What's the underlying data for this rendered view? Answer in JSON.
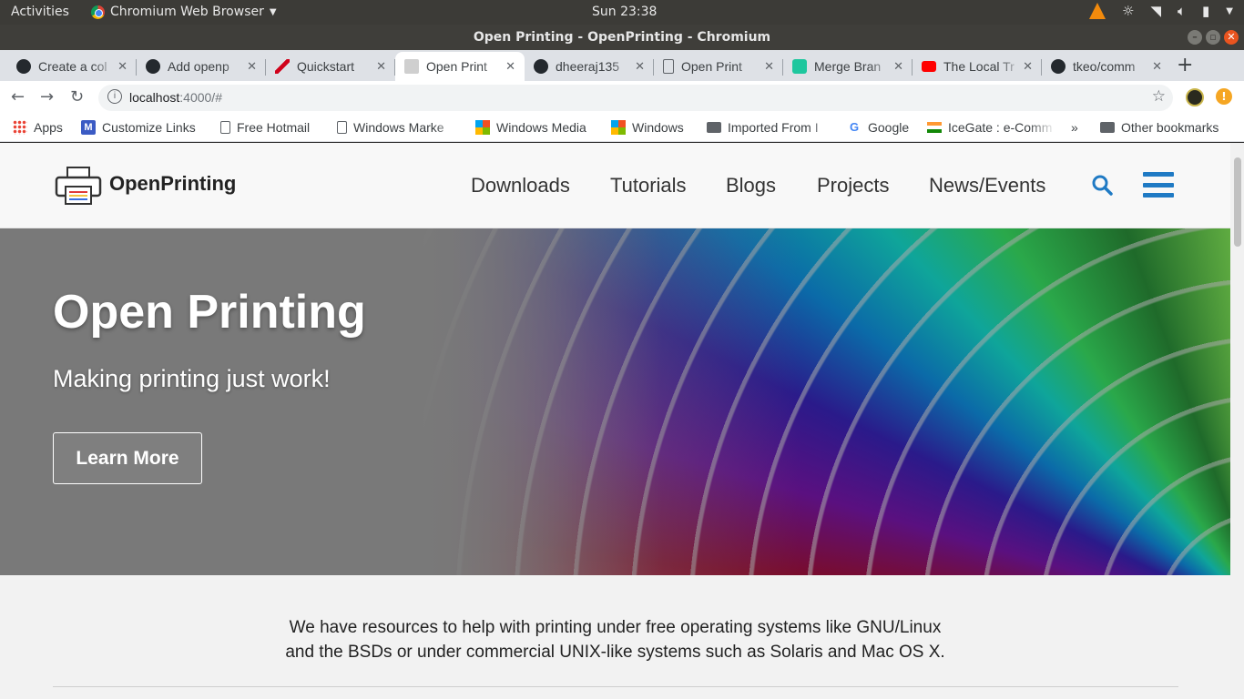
{
  "system_bar": {
    "activities": "Activities",
    "app_name": "Chromium Web Browser",
    "clock": "Sun 23:38"
  },
  "window": {
    "title": "Open Printing - OpenPrinting - Chromium"
  },
  "tabs": [
    {
      "label": "Create a col",
      "icon": "github-icon",
      "active": false
    },
    {
      "label": "Add openp",
      "icon": "github-icon",
      "active": false
    },
    {
      "label": "Quickstart",
      "icon": "pen-icon",
      "active": false
    },
    {
      "label": "Open Print",
      "icon": "printer-icon",
      "active": true
    },
    {
      "label": "dheeraj135",
      "icon": "github-icon",
      "active": false
    },
    {
      "label": "Open Print",
      "icon": "page-icon",
      "active": false
    },
    {
      "label": "Merge Bran",
      "icon": "b-icon",
      "active": false
    },
    {
      "label": "The Local Tr",
      "icon": "youtube-icon",
      "active": false
    },
    {
      "label": "tkeo/comm",
      "icon": "github-icon",
      "active": false
    }
  ],
  "address_bar": {
    "host": "localhost",
    "path": ":4000/#"
  },
  "bookmarks": {
    "items": [
      "Apps",
      "Customize Links",
      "Free Hotmail",
      "Windows Marke",
      "Windows Media",
      "Windows",
      "Imported From I",
      "Google",
      "IceGate : e-Comm"
    ],
    "overflow": "»",
    "other": "Other bookmarks"
  },
  "site": {
    "brand": "OpenPrinting",
    "nav": [
      "Downloads",
      "Tutorials",
      "Blogs",
      "Projects",
      "News/Events"
    ],
    "accent": "#1f7ac4"
  },
  "hero": {
    "title": "Open Printing",
    "subtitle": "Making printing just work!",
    "cta": "Learn More"
  },
  "intro": {
    "line1": "We have resources to help with printing under free operating systems like GNU/Linux",
    "line2": "and the BSDs or under commercial UNIX-like systems such as Solaris and Mac OS X."
  }
}
